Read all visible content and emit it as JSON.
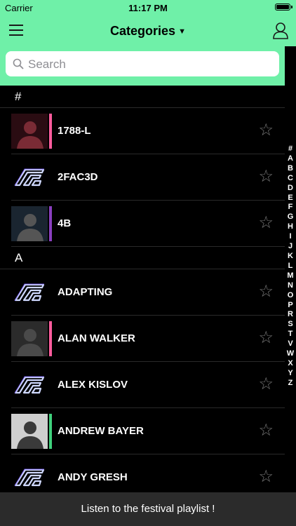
{
  "status": {
    "carrier": "Carrier",
    "time": "11:17 PM"
  },
  "nav": {
    "title": "Categories",
    "menu_icon": "hamburger-icon",
    "user_icon": "user-icon"
  },
  "search": {
    "placeholder": "Search"
  },
  "sections": [
    {
      "header": "#",
      "items": [
        {
          "name": "1788-L",
          "thumb": "photo",
          "accent": "#ff5c9d"
        },
        {
          "name": "2FAC3D",
          "thumb": "logo",
          "accent": ""
        },
        {
          "name": "4B",
          "thumb": "photo",
          "accent": "#8a3fbf"
        }
      ]
    },
    {
      "header": "A",
      "items": [
        {
          "name": "ADAPTING",
          "thumb": "logo",
          "accent": ""
        },
        {
          "name": "ALAN WALKER",
          "thumb": "photo",
          "accent": "#ff5c9d"
        },
        {
          "name": "ALEX KISLOV",
          "thumb": "logo",
          "accent": ""
        },
        {
          "name": "ANDREW BAYER",
          "thumb": "photo",
          "accent": "#3fd17c"
        },
        {
          "name": "ANDY GRESH",
          "thumb": "logo",
          "accent": ""
        }
      ]
    }
  ],
  "index": [
    "#",
    "A",
    "B",
    "C",
    "D",
    "E",
    "F",
    "G",
    "H",
    "I",
    "J",
    "K",
    "L",
    "M",
    "N",
    "O",
    "P",
    "R",
    "S",
    "T",
    "V",
    "W",
    "X",
    "Y",
    "Z"
  ],
  "bottom": {
    "label": "Listen to the festival playlist !"
  },
  "colors": {
    "accent_green": "#6ff0a8",
    "star": "#777777"
  }
}
